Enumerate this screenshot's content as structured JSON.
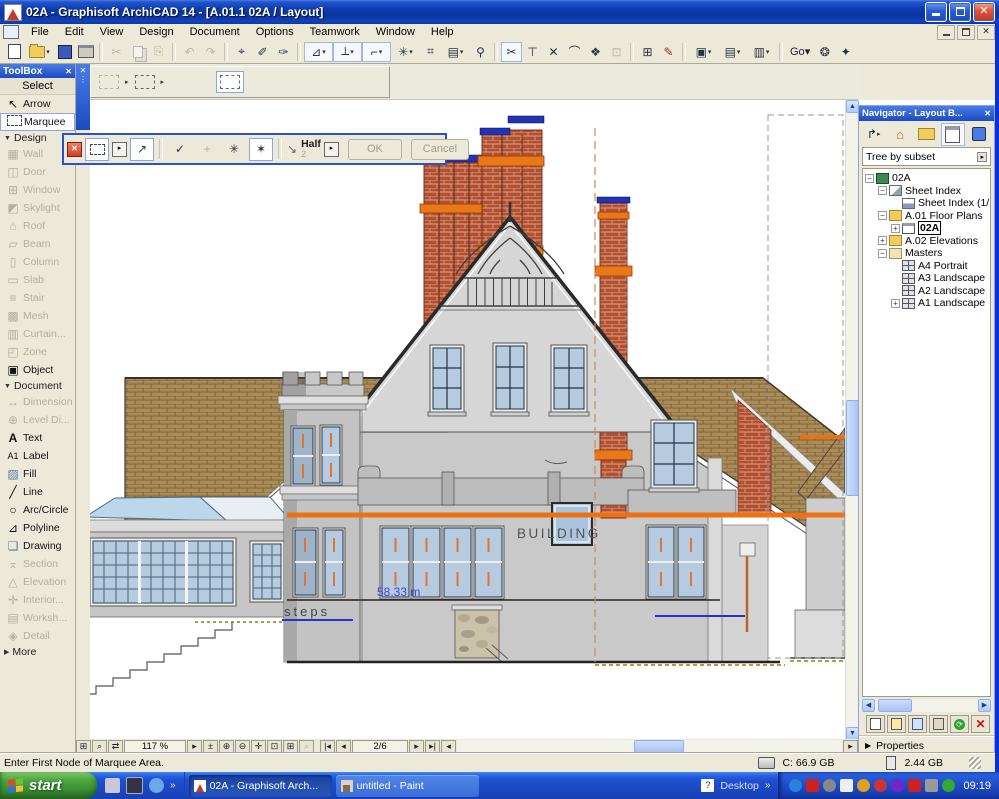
{
  "titlebar": {
    "title": "02A - Graphisoft ArchiCAD 14 - [A.01.1 02A / Layout]"
  },
  "menu": {
    "items": [
      "File",
      "Edit",
      "View",
      "Design",
      "Document",
      "Options",
      "Teamwork",
      "Window",
      "Help"
    ]
  },
  "toolbar": {
    "go_label": "Go"
  },
  "toolbox": {
    "title": "ToolBox",
    "select_header": "Select",
    "arrow_label": "Arrow",
    "marquee_label": "Marquee",
    "design_header": "Design",
    "design_items": [
      "Wall",
      "Door",
      "Window",
      "Skylight",
      "Roof",
      "Beam",
      "Column",
      "Slab",
      "Stair",
      "Mesh",
      "Curtain...",
      "Zone",
      "Object"
    ],
    "document_header": "Document",
    "document_items": [
      "Dimension",
      "Level Di...",
      "Text",
      "Label",
      "Fill",
      "Line",
      "Arc/Circle",
      "Polyline",
      "Drawing",
      "Section",
      "Elevation",
      "Interior...",
      "Worksh...",
      "Detail"
    ],
    "more_label": "More"
  },
  "marquee_palette": {
    "option_label": "Half",
    "option_value": "2",
    "ok_label": "OK",
    "cancel_label": "Cancel"
  },
  "navigator": {
    "title": "Navigator - Layout B...",
    "tree_mode": "Tree by subset",
    "tree": [
      {
        "label": "02A",
        "depth": 0,
        "expand": "minus",
        "icon": "project-book"
      },
      {
        "label": "Sheet Index",
        "depth": 1,
        "expand": "minus",
        "icon": "subset-layout"
      },
      {
        "label": "Sheet Index (1/",
        "depth": 2,
        "expand": "none",
        "icon": "drawing-sheet"
      },
      {
        "label": "A.01 Floor Plans",
        "depth": 1,
        "expand": "minus",
        "icon": "subset-folder"
      },
      {
        "label": "02A",
        "depth": 2,
        "expand": "plus",
        "icon": "layout-page",
        "selected": true
      },
      {
        "label": "A.02 Elevations",
        "depth": 1,
        "expand": "plus",
        "icon": "subset-folder"
      },
      {
        "label": "Masters",
        "depth": 1,
        "expand": "minus",
        "icon": "masters-folder"
      },
      {
        "label": "A4 Portrait",
        "depth": 2,
        "expand": "none",
        "icon": "master-page"
      },
      {
        "label": "A3 Landscape",
        "depth": 2,
        "expand": "none",
        "icon": "master-page"
      },
      {
        "label": "A2 Landscape",
        "depth": 2,
        "expand": "none",
        "icon": "master-page"
      },
      {
        "label": "A1 Landscape",
        "depth": 2,
        "expand": "plus",
        "icon": "master-page"
      }
    ],
    "properties_label": "Properties"
  },
  "view_controls": {
    "zoom_value": "117 %",
    "page_value": "2/6"
  },
  "statusbar": {
    "message": "Enter First Node of Marquee Area.",
    "disk_space": "C: 66.9 GB",
    "memory": "2.44 GB"
  },
  "taskbar": {
    "start_label": "start",
    "tasks": [
      "02A - Graphisoft Arch...",
      "untitled - Paint"
    ],
    "desktop_label": "Desktop",
    "clock": "09:19"
  },
  "drawing": {
    "building_label": "BUILDING",
    "steps_label": "steps",
    "level_label": "58.33 m"
  },
  "colors": {
    "accent_orange": "#ee7010",
    "chimney_cap_blue": "#2233bb",
    "glass_blue": "#b7cbe0",
    "brick_red": "#b25034",
    "roof_tan": "#ab8b57",
    "titlebar_blue": "#0d36a8",
    "taskbar_blue": "#1f50d0",
    "start_green": "#3a9a38",
    "selection_blue": "#316ac5"
  }
}
